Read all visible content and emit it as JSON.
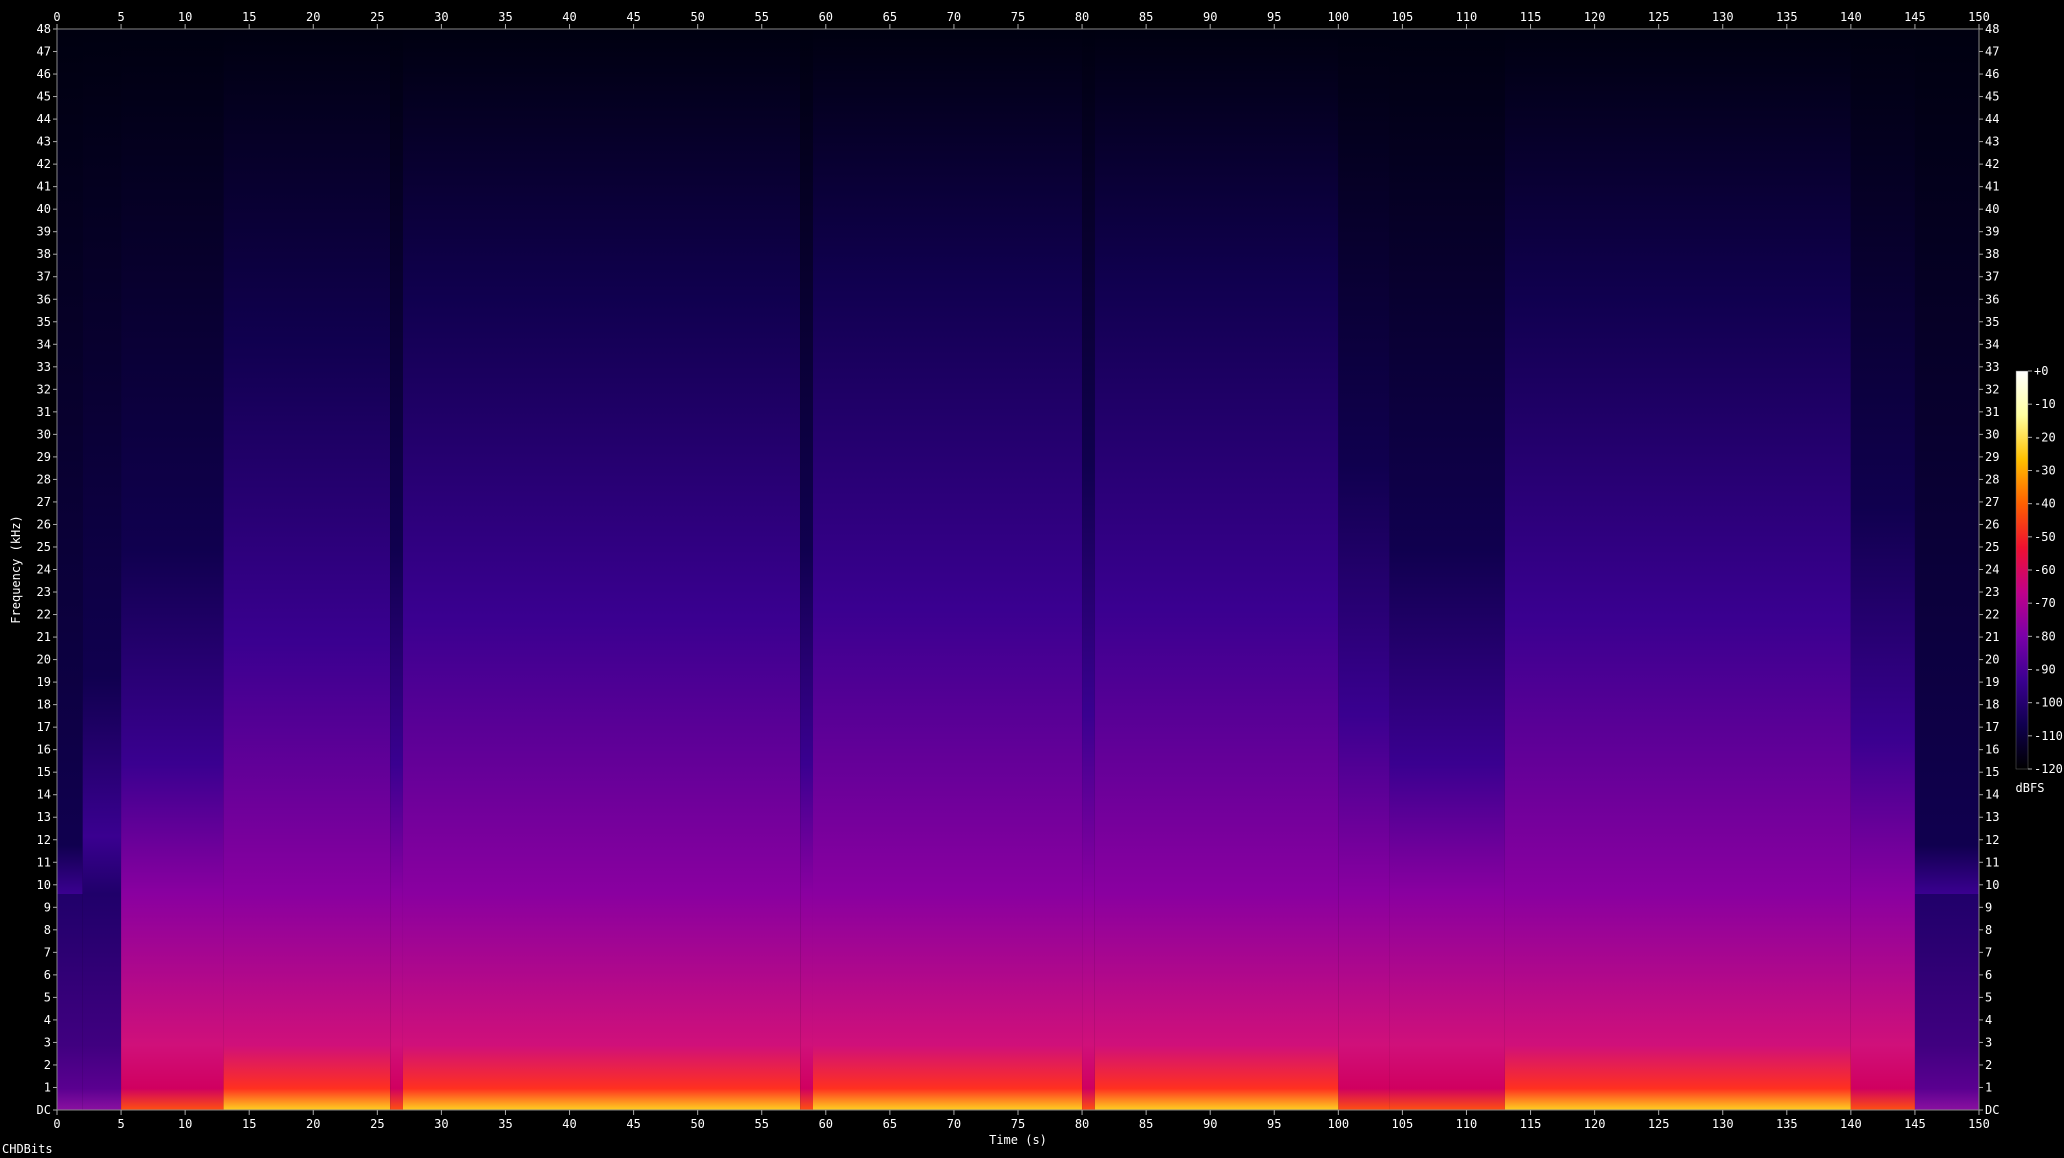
{
  "chart_data": {
    "type": "heatmap",
    "title": "",
    "xlabel": "Time (s)",
    "ylabel": "Frequency (kHz)",
    "xlim": [
      0,
      150
    ],
    "ylim": [
      0,
      48
    ],
    "x_ticks": [
      "0",
      "5",
      "10",
      "15",
      "20",
      "25",
      "30",
      "35",
      "40",
      "45",
      "50",
      "55",
      "60",
      "65",
      "70",
      "75",
      "80",
      "85",
      "90",
      "95",
      "100",
      "105",
      "110",
      "115",
      "120",
      "125",
      "130",
      "135",
      "140",
      "145",
      "150"
    ],
    "y_ticks": [
      "DC",
      "1",
      "2",
      "3",
      "4",
      "5",
      "6",
      "7",
      "8",
      "9",
      "10",
      "11",
      "12",
      "13",
      "14",
      "15",
      "16",
      "17",
      "18",
      "19",
      "20",
      "21",
      "22",
      "23",
      "24",
      "25",
      "26",
      "27",
      "28",
      "29",
      "30",
      "31",
      "32",
      "33",
      "34",
      "35",
      "36",
      "37",
      "38",
      "39",
      "40",
      "41",
      "42",
      "43",
      "44",
      "45",
      "46",
      "47",
      "48"
    ],
    "colorbar": {
      "label": "dBFS",
      "range": [
        -120,
        0
      ],
      "ticks": [
        "+0",
        "-10",
        "-20",
        "-30",
        "-40",
        "-50",
        "-60",
        "-70",
        "-80",
        "-90",
        "-100",
        "-110",
        "-120"
      ],
      "colors": [
        "#000000",
        "#10004f",
        "#3a0090",
        "#7a00a8",
        "#c0008a",
        "#ee1030",
        "#ff6000",
        "#ffc000",
        "#ffffa0",
        "#ffffff"
      ]
    },
    "energy_segments": [
      {
        "start": 0,
        "end": 2,
        "level": 0.25
      },
      {
        "start": 2,
        "end": 5,
        "level": 0.45
      },
      {
        "start": 5,
        "end": 13,
        "level": 0.6
      },
      {
        "start": 13,
        "end": 26,
        "level": 0.85
      },
      {
        "start": 26,
        "end": 27,
        "level": 0.6
      },
      {
        "start": 27,
        "end": 58,
        "level": 0.9
      },
      {
        "start": 58,
        "end": 59,
        "level": 0.6
      },
      {
        "start": 59,
        "end": 80,
        "level": 0.92
      },
      {
        "start": 80,
        "end": 81,
        "level": 0.7
      },
      {
        "start": 81,
        "end": 100,
        "level": 0.92
      },
      {
        "start": 100,
        "end": 104,
        "level": 0.7
      },
      {
        "start": 104,
        "end": 113,
        "level": 0.6
      },
      {
        "start": 113,
        "end": 140,
        "level": 0.9
      },
      {
        "start": 140,
        "end": 145,
        "level": 0.65
      },
      {
        "start": 145,
        "end": 150,
        "level": 0.25
      }
    ]
  },
  "footer": {
    "text": "CHDBits"
  }
}
